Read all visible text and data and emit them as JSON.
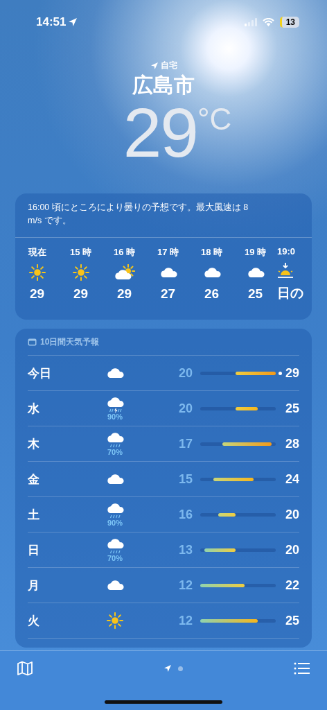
{
  "status_bar": {
    "time": "14:51",
    "battery": "13"
  },
  "location": {
    "label": "自宅",
    "city": "広島市",
    "temperature": "29",
    "unit": "°C"
  },
  "hourly": {
    "summary": "16:00 頃にところにより曇りの予想です。最大風速は 8 m/s です。",
    "items": [
      {
        "time": "現在",
        "kind": "sun",
        "value": "29"
      },
      {
        "time": "15 時",
        "kind": "sun",
        "value": "29"
      },
      {
        "time": "16 時",
        "kind": "partly-cloudy",
        "value": "29"
      },
      {
        "time": "17 時",
        "kind": "cloud",
        "value": "27"
      },
      {
        "time": "18 時",
        "kind": "cloud",
        "value": "26"
      },
      {
        "time": "19 時",
        "kind": "cloud",
        "value": "25"
      },
      {
        "time": "19:0",
        "kind": "sunset",
        "value": "日の"
      }
    ]
  },
  "daily": {
    "title": "10日間天気予報",
    "days": [
      {
        "day": "今日",
        "kind": "cloud",
        "low": "20",
        "high": "29",
        "current_marker": true
      },
      {
        "day": "水",
        "kind": "thunderstorm",
        "precipitation": "90%",
        "low": "20",
        "high": "25",
        "current_marker": false
      },
      {
        "day": "木",
        "kind": "rain",
        "precipitation": "70%",
        "low": "17",
        "high": "28",
        "current_marker": false
      },
      {
        "day": "金",
        "kind": "cloud",
        "low": "15",
        "high": "24",
        "current_marker": false
      },
      {
        "day": "土",
        "kind": "rain",
        "precipitation": "90%",
        "low": "16",
        "high": "20",
        "current_marker": false
      },
      {
        "day": "日",
        "kind": "rain",
        "precipitation": "70%",
        "low": "13",
        "high": "20",
        "current_marker": false
      },
      {
        "day": "月",
        "kind": "cloud",
        "low": "12",
        "high": "22",
        "current_marker": false
      },
      {
        "day": "火",
        "kind": "sun",
        "low": "12",
        "high": "25",
        "current_marker": false
      }
    ]
  },
  "pages": [
    {
      "kind": "location",
      "selected": true
    },
    {
      "kind": "dot",
      "selected": false
    }
  ]
}
